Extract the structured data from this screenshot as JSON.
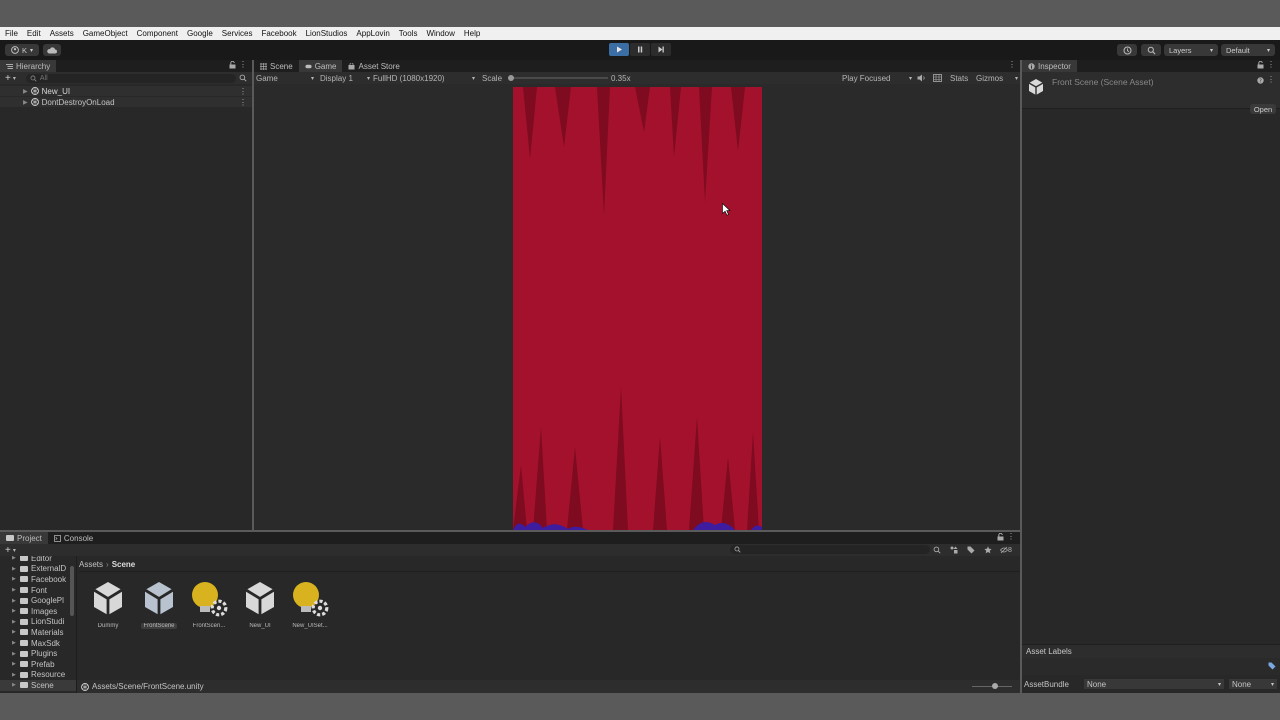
{
  "menu": [
    "File",
    "Edit",
    "Assets",
    "GameObject",
    "Component",
    "Google",
    "Services",
    "Facebook",
    "LionStudios",
    "AppLovin",
    "Tools",
    "Window",
    "Help"
  ],
  "toolbar": {
    "account": "K",
    "layers": "Layers",
    "layout": "Default"
  },
  "hierarchy": {
    "tab": "Hierarchy",
    "search_placeholder": "All",
    "items": [
      "New_UI",
      "DontDestroyOnLoad"
    ]
  },
  "viewtabs": {
    "scene": "Scene",
    "game": "Game",
    "asset_store": "Asset Store"
  },
  "gamebar": {
    "mode": "Game",
    "display": "Display 1",
    "resolution": "FullHD (1080x1920)",
    "scale_label": "Scale",
    "scale_value": "0.35x",
    "play_focused": "Play Focused",
    "stats": "Stats",
    "gizmos": "Gizmos"
  },
  "game_colors": {
    "curtain": "#a4112c",
    "shadow": "#7e0b1f",
    "base": "#3d1ca0",
    "background": "#2a2a2a"
  },
  "inspector": {
    "tab": "Inspector",
    "title": "Front Scene (Scene Asset)",
    "open_button": "Open",
    "asset_labels": "Asset Labels",
    "assetbundle_label": "AssetBundle",
    "assetbundle_value": "None",
    "variant_value": "None"
  },
  "project": {
    "tab_project": "Project",
    "tab_console": "Console",
    "breadcrumb": [
      "Assets",
      "Scene"
    ],
    "folders": [
      "Editor",
      "ExternalD",
      "Facebook",
      "Font",
      "GooglePl",
      "Images",
      "LionStudi",
      "Materials",
      "MaxSdk",
      "Plugins",
      "Prefab",
      "Resource",
      "Scene"
    ],
    "assets": [
      {
        "label": "Dummy",
        "icon": "unity-scene-icon",
        "selected": false
      },
      {
        "label": "FrontScene",
        "icon": "unity-scene-icon",
        "selected": true
      },
      {
        "label": "FrontScen...",
        "icon": "lighting-settings-icon",
        "selected": false
      },
      {
        "label": "New_UI",
        "icon": "unity-scene-icon",
        "selected": false
      },
      {
        "label": "New_UISet...",
        "icon": "lighting-settings-icon",
        "selected": false
      }
    ],
    "status_path": "Assets/Scene/FrontScene.unity",
    "hidden_count": "8"
  }
}
